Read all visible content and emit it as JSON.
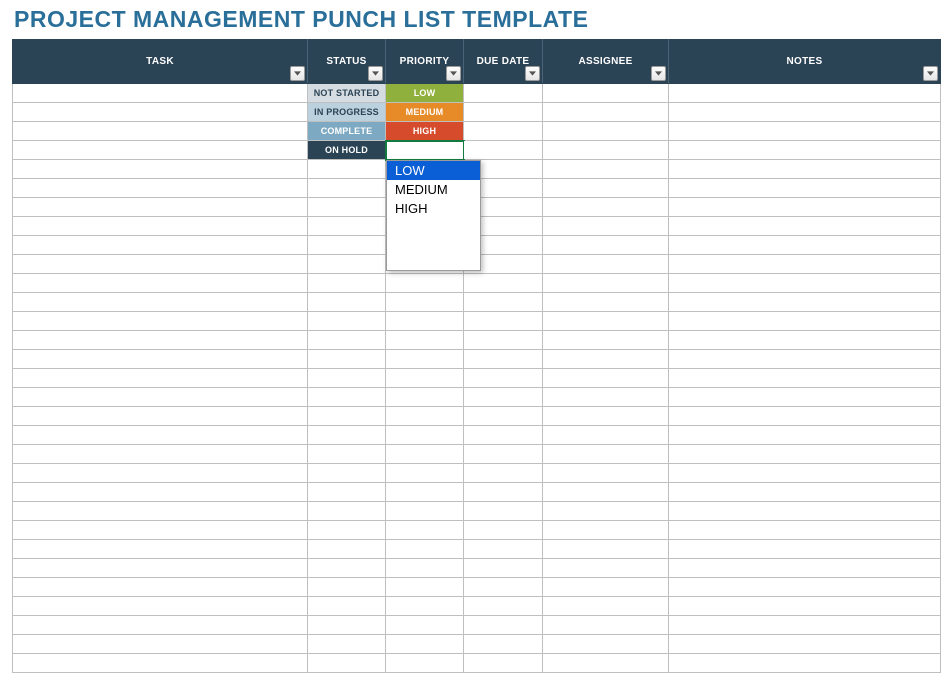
{
  "title": "PROJECT MANAGEMENT PUNCH LIST TEMPLATE",
  "columns": {
    "task": "TASK",
    "status": "STATUS",
    "priority": "PRIORITY",
    "due_date": "DUE DATE",
    "assignee": "ASSIGNEE",
    "notes": "NOTES"
  },
  "status_values": {
    "not_started": "NOT STARTED",
    "in_progress": "IN PROGRESS",
    "complete": "COMPLETE",
    "on_hold": "ON HOLD"
  },
  "priority_values": {
    "low": "LOW",
    "medium": "MEDIUM",
    "high": "HIGH"
  },
  "dropdown": {
    "options": [
      "LOW",
      "MEDIUM",
      "HIGH"
    ],
    "selected_index": 0
  },
  "rows": [
    {
      "status": "not_started",
      "priority": "low"
    },
    {
      "status": "in_progress",
      "priority": "medium"
    },
    {
      "status": "complete",
      "priority": "high"
    },
    {
      "status": "on_hold",
      "priority": null,
      "active_dropdown": true
    }
  ],
  "empty_row_count": 27,
  "colors": {
    "header_bg": "#2a4355",
    "title": "#2a6f9a",
    "status_not_started": "#d6dde2",
    "status_in_progress": "#bcd1de",
    "status_complete": "#7ea9c2",
    "status_on_hold": "#2a4355",
    "priority_low": "#8fb03c",
    "priority_medium": "#e78b28",
    "priority_high": "#d64b2c",
    "dropdown_selected": "#0a5fd6",
    "active_cell_outline": "#107c41"
  }
}
